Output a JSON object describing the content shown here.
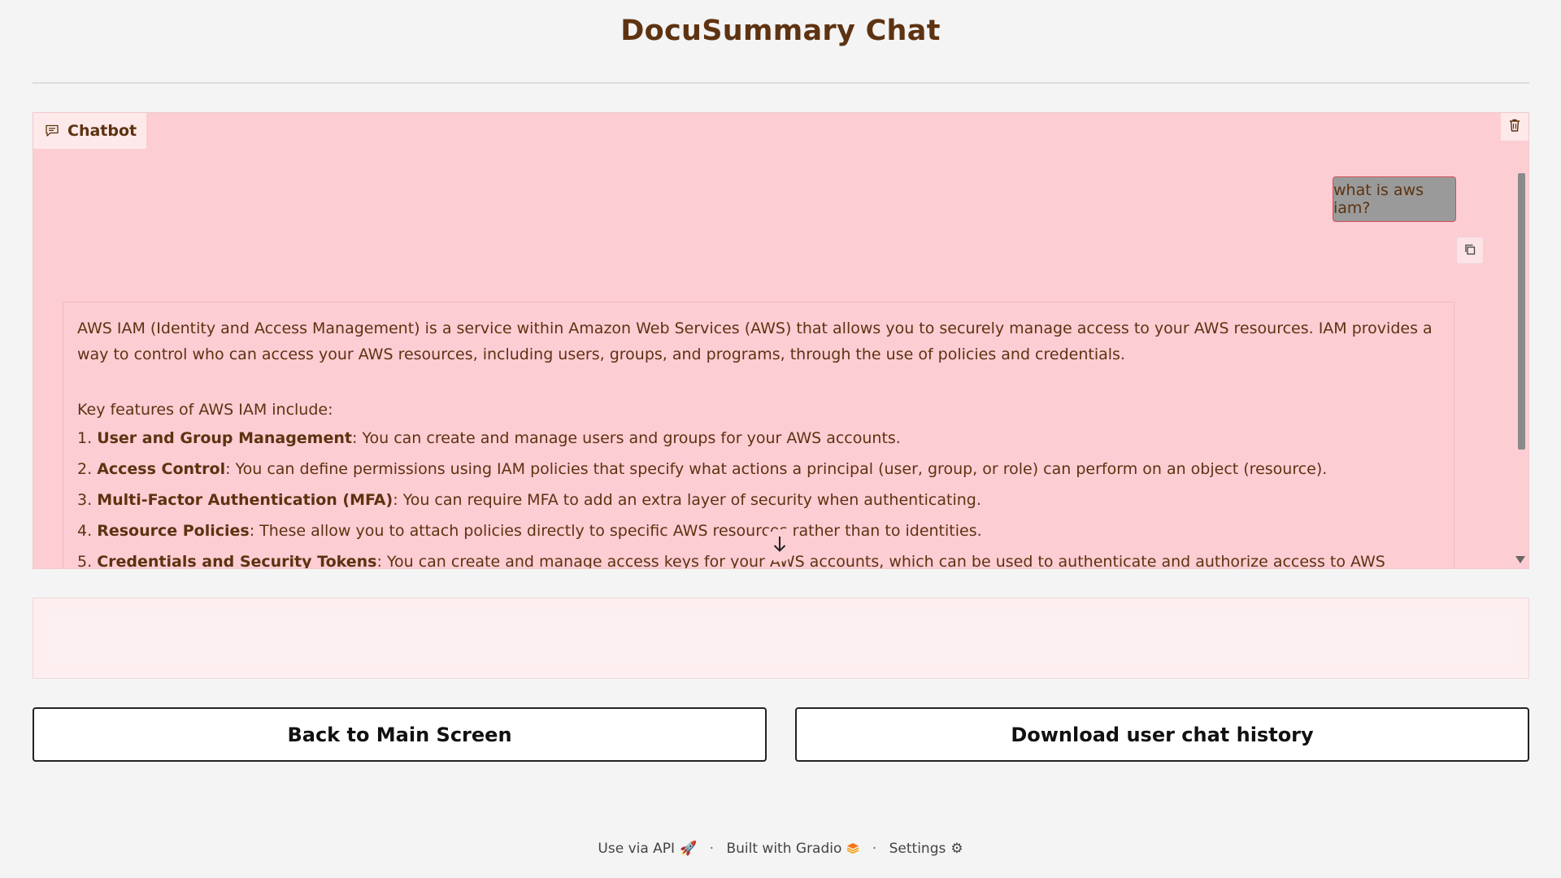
{
  "page": {
    "title": "DocuSummary Chat"
  },
  "chatbot": {
    "label": "Chatbot",
    "user_message": "what is aws iam?",
    "bot_message": {
      "intro": "AWS IAM (Identity and Access Management) is a service within Amazon Web Services (AWS) that allows you to securely manage access to your AWS resources. IAM provides a way to control who can access your AWS resources, including users, groups, and programs, through the use of policies and credentials.",
      "features_heading": "Key features of AWS IAM include:",
      "features": [
        {
          "num": "1.",
          "title": "User and Group Management",
          "text": ": You can create and manage users and groups for your AWS accounts."
        },
        {
          "num": "2.",
          "title": "Access Control",
          "text": ": You can define permissions using IAM policies that specify what actions a principal (user, group, or role) can perform on an object (resource)."
        },
        {
          "num": "3.",
          "title": "Multi-Factor Authentication (MFA)",
          "text": ": You can require MFA to add an extra layer of security when authenticating."
        },
        {
          "num": "4.",
          "title": "Resource Policies",
          "text": ": These allow you to attach policies directly to specific AWS resources rather than to identities."
        },
        {
          "num": "5.",
          "title": "Credentials and Security Tokens",
          "text": ": You can create and manage access keys for your AWS accounts, which can be used to authenticate and authorize access to AWS services."
        }
      ]
    }
  },
  "input": {
    "placeholder": "",
    "value": ""
  },
  "buttons": {
    "back": "Back to Main Screen",
    "download": "Download user chat history"
  },
  "footer": {
    "api": "Use via API",
    "built": "Built with Gradio",
    "settings": "Settings",
    "separator": "·"
  },
  "icons": {
    "chatbot": "chat-bubble-icon",
    "clear": "trash-icon",
    "copy": "copy-icon",
    "scroll_down": "arrow-down-icon",
    "api": "rocket-icon",
    "gradio": "gradio-logo-icon",
    "settings": "gear-icon"
  },
  "colors": {
    "title": "#5e3312",
    "chat_bg": "#fdcdd4",
    "user_bubble": "#9a9a9a",
    "text": "#5c3310"
  }
}
